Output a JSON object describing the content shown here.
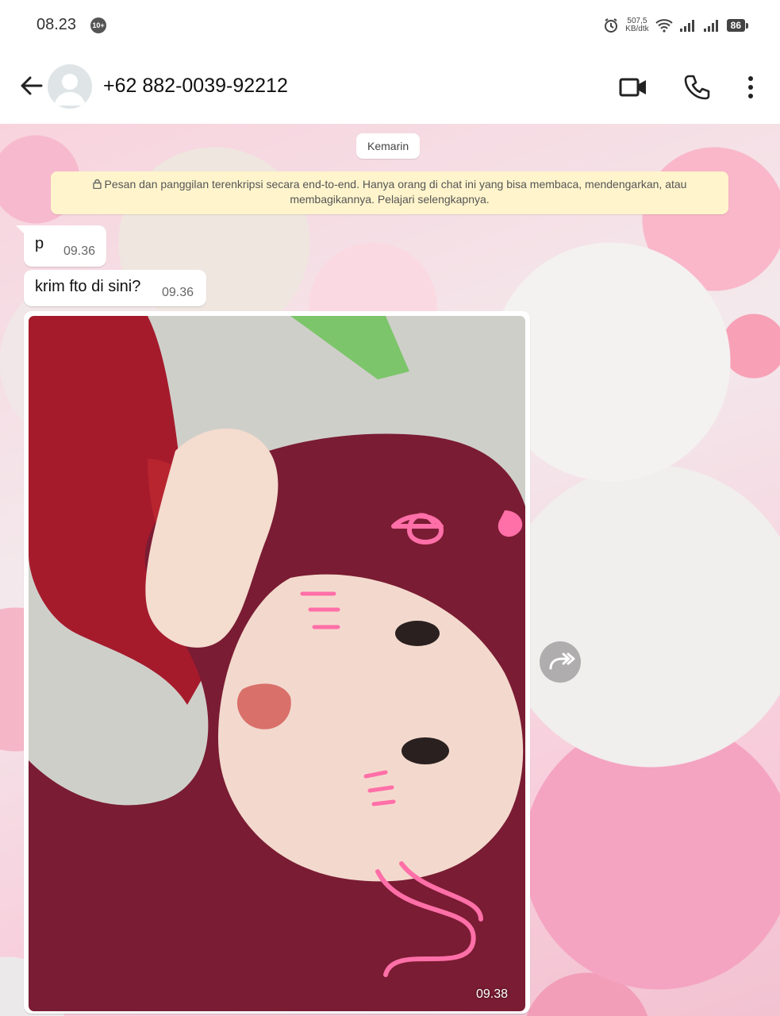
{
  "status_bar": {
    "time": "08.23",
    "notification_badge": "10+",
    "net_speed_value": "507,5",
    "net_speed_unit": "KB/dtk",
    "battery": "86"
  },
  "header": {
    "contact_name": "+62 882-0039-92212",
    "icons": [
      "back-arrow-icon",
      "avatar",
      "video-call-icon",
      "phone-icon",
      "more-vert-icon"
    ]
  },
  "chat": {
    "date_chip": "Kemarin",
    "encryption_notice": "Pesan dan panggilan terenkripsi secara end-to-end. Hanya orang di chat ini yang bisa membaca, mendengarkan, atau membagikannya. Pelajari selengkapnya.",
    "messages": [
      {
        "text": "p",
        "time": "09.36"
      },
      {
        "text": "krim fto di sini?",
        "time": "09.36"
      }
    ],
    "photo_message": {
      "time": "09.38"
    }
  },
  "colors": {
    "notice_bg": "#fff4cc",
    "bubble_bg": "#ffffff",
    "wallpaper_pink": "#f8cddb",
    "hijab_maroon": "#7a1c33"
  }
}
